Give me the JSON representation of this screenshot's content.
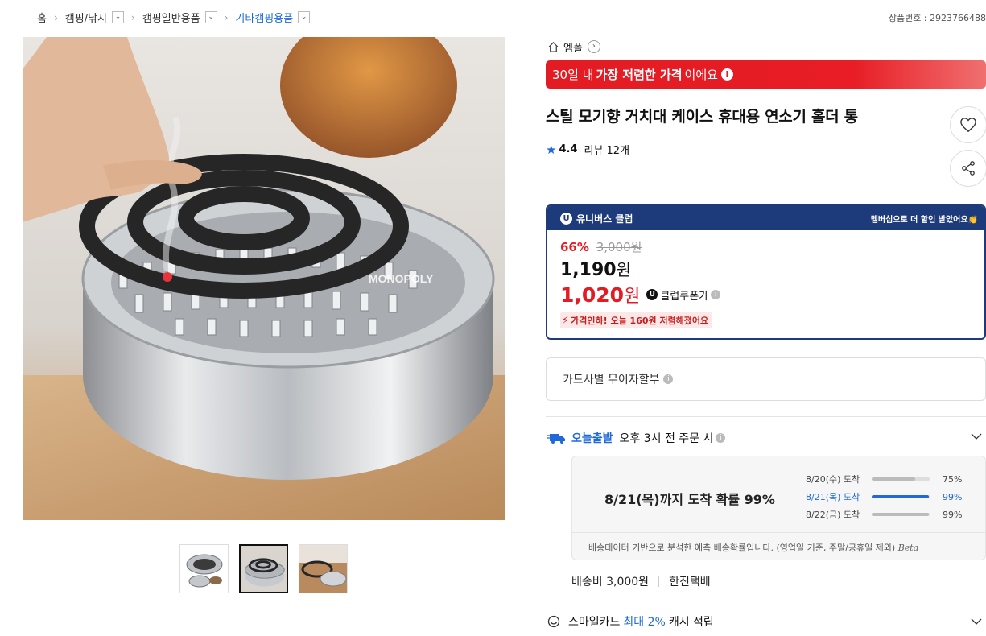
{
  "breadcrumb": {
    "home": "홈",
    "items": [
      {
        "label": "캠핑/낚시"
      },
      {
        "label": "캠핑일반용품"
      },
      {
        "label": "기타캠핑용품"
      }
    ]
  },
  "product_no": "상품번호 : 2923766488",
  "gallery": {
    "watermark": "MONOPOLY",
    "thumbs_count": 3,
    "active_thumb": 2
  },
  "store": {
    "name": "엠폴"
  },
  "lowest_banner": {
    "pre": "30일 내",
    "bold": "가장 저렴한 가격",
    "post": "이에요"
  },
  "title": "스틸 모기향 거치대 케이스 휴대용 연소기 홀더 통",
  "rating": {
    "score": "4.4",
    "reviews": "리뷰 12개"
  },
  "club": {
    "name": "유니버스 클럽",
    "promo": "멤버십으로 더 할인 받았어요👏",
    "discount_pct": "66%",
    "original_price": "3,000원",
    "sale_price": "1,190",
    "sale_unit": "원",
    "coupon_price": "1,020",
    "coupon_unit": "원",
    "coupon_label": "클럽쿠폰가",
    "drop_note": "가격인하! 오늘 160원 저렴해졌어요"
  },
  "installment": {
    "label": "카드사별 무이자할부"
  },
  "shipping": {
    "badge": "오늘출발",
    "condition": "오후 3시 전 주문 시",
    "headline": "8/21(목)까지 도착 확률 99%",
    "rows": [
      {
        "date": "8/20(수) 도착",
        "pct": "75%",
        "value": 0.75,
        "highlight": false
      },
      {
        "date": "8/21(목) 도착",
        "pct": "99%",
        "value": 0.99,
        "highlight": true
      },
      {
        "date": "8/22(금) 도착",
        "pct": "99%",
        "value": 0.99,
        "highlight": false
      }
    ],
    "note": "배송데이터 기반으로 분석한 예측 배송확률입니다. (영업일 기준, 주말/공휴일 제외)",
    "beta": "Beta",
    "fee": "배송비 3,000원",
    "carrier": "한진택배"
  },
  "smilecard": {
    "pre": "스마일카드",
    "highlight": "최대 2%",
    "post": "캐시 적립"
  },
  "colors": {
    "accent_blue": "#1f6ad8",
    "sale_red": "#e31b23",
    "club_navy": "#1d3a7a"
  }
}
